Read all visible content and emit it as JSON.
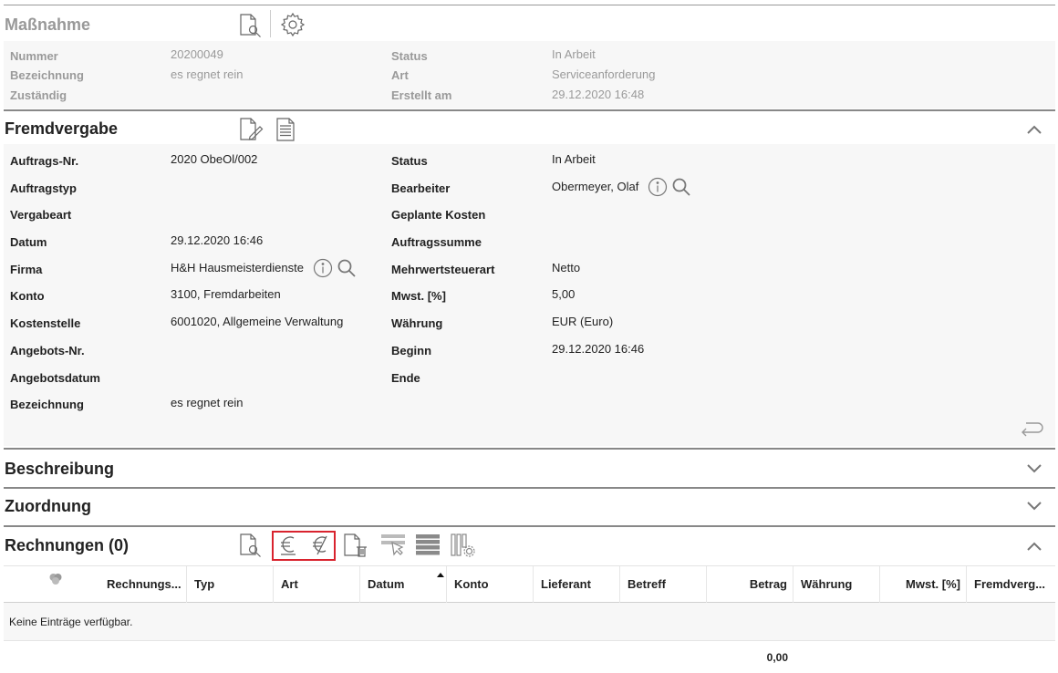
{
  "massnahme": {
    "title": "Maßnahme",
    "fields_left": [
      {
        "label": "Nummer",
        "value": "20200049"
      },
      {
        "label": "Bezeichnung",
        "value": "es regnet rein"
      },
      {
        "label": "Zuständig",
        "value": ""
      }
    ],
    "fields_right": [
      {
        "label": "Status",
        "value": "In Arbeit"
      },
      {
        "label": "Art",
        "value": "Serviceanforderung"
      },
      {
        "label": "Erstellt am",
        "value": "29.12.2020 16:48"
      }
    ]
  },
  "fremdvergabe": {
    "title": "Fremdvergabe",
    "fields_left": [
      {
        "label": "Auftrags-Nr.",
        "value": "2020 ObeOl/002"
      },
      {
        "label": "Auftragstyp",
        "value": ""
      },
      {
        "label": "Vergabeart",
        "value": ""
      },
      {
        "label": "Datum",
        "value": "29.12.2020 16:46"
      },
      {
        "label": "Firma",
        "value": "H&H Hausmeisterdienste"
      },
      {
        "label": "Konto",
        "value": "3100, Fremdarbeiten"
      },
      {
        "label": "Kostenstelle",
        "value": "6001020, Allgemeine Verwaltung"
      },
      {
        "label": "Angebots-Nr.",
        "value": ""
      },
      {
        "label": "Angebotsdatum",
        "value": ""
      },
      {
        "label": "Bezeichnung",
        "value": "es regnet rein"
      }
    ],
    "fields_right": [
      {
        "label": "Status",
        "value": "In Arbeit"
      },
      {
        "label": "Bearbeiter",
        "value": "Obermeyer, Olaf"
      },
      {
        "label": "Geplante Kosten",
        "value": ""
      },
      {
        "label": "Auftragssumme",
        "value": ""
      },
      {
        "label": "Mehrwertsteuerart",
        "value": "Netto"
      },
      {
        "label": "Mwst. [%]",
        "value": "5,00"
      },
      {
        "label": "Währung",
        "value": "EUR (Euro)"
      },
      {
        "label": "Beginn",
        "value": "29.12.2020 16:46"
      },
      {
        "label": "Ende",
        "value": ""
      }
    ]
  },
  "beschreibung": {
    "title": "Beschreibung"
  },
  "zuordnung": {
    "title": "Zuordnung"
  },
  "rechnungen": {
    "title": "Rechnungen (0)",
    "columns": [
      "Rechnungs...",
      "Typ",
      "Art",
      "Datum",
      "Konto",
      "Lieferant",
      "Betreff",
      "Betrag",
      "Währung",
      "Mwst. [%]",
      "Fremdverg..."
    ],
    "empty_message": "Keine Einträge verfügbar.",
    "total": "0,00"
  },
  "colors": {
    "highlight": "#d9232e",
    "divider": "#888888",
    "panel": "#f7f7f7",
    "muted_text": "#9a9a9a"
  }
}
